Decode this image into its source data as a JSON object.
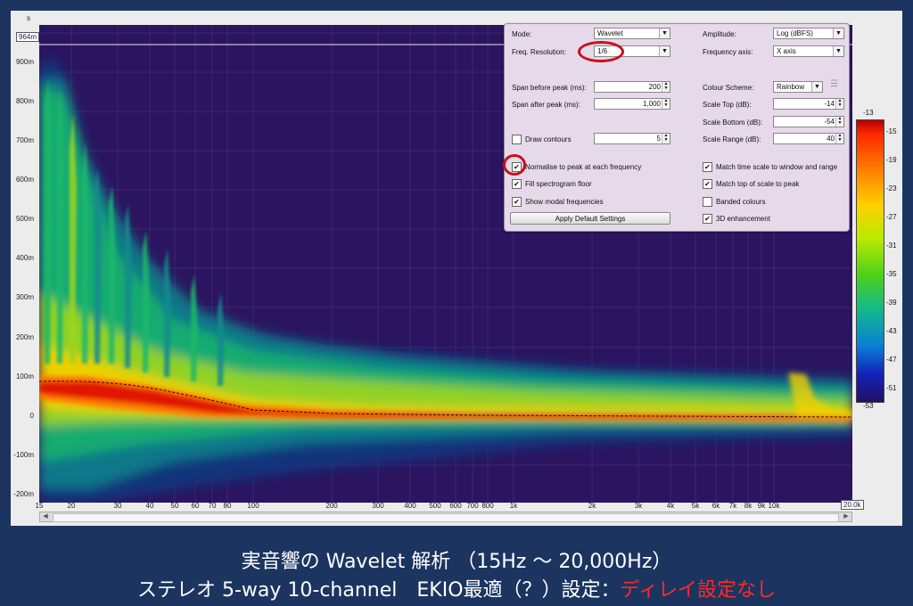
{
  "plot": {
    "unit_top": "s",
    "marker_label": "964m",
    "y_ticks": [
      "900m",
      "800m",
      "700m",
      "600m",
      "500m",
      "400m",
      "300m",
      "200m",
      "100m",
      "0",
      "-100m",
      "-200m"
    ],
    "x_ticks": [
      "15",
      "20",
      "30",
      "40",
      "50",
      "60",
      "70",
      "80",
      "100",
      "200",
      "300",
      "400",
      "500",
      "600",
      "700",
      "800",
      "1k",
      "2k",
      "3k",
      "4k",
      "5k",
      "6k",
      "7k",
      "8k",
      "9k",
      "10k",
      "20k"
    ],
    "freq_readout": "20.0k"
  },
  "panel": {
    "mode_label": "Mode:",
    "mode_value": "Wavelet",
    "amplitude_label": "Amplitude:",
    "amplitude_value": "Log (dBFS)",
    "freq_res_label": "Freq. Resolution:",
    "freq_res_value": "1/6",
    "freq_axis_label": "Frequency axis:",
    "freq_axis_value": "X axis",
    "span_before_label": "Span before peak (ms):",
    "span_before_value": "200",
    "span_after_label": "Span after peak (ms):",
    "span_after_value": "1,000",
    "colour_scheme_label": "Colour Scheme:",
    "colour_scheme_value": "Rainbow",
    "scale_top_label": "Scale Top (dB):",
    "scale_top_value": "-14",
    "scale_bottom_label": "Scale Bottom (dB):",
    "scale_bottom_value": "-54",
    "scale_range_label": "Scale Range (dB):",
    "scale_range_value": "40",
    "draw_contours_label": "Draw contours",
    "draw_contours_value": "5",
    "normalise_label": "Normalise to peak at each frequency",
    "fill_floor_label": "Fill spectrogram floor",
    "show_modal_label": "Show modal frequencies",
    "match_time_label": "Match time scale to window and range",
    "match_top_label": "Match top of scale to peak",
    "banded_label": "Banded colours",
    "enhance_3d_label": "3D enhancement",
    "apply_default_label": "Apply Default Settings",
    "checks": {
      "draw_contours": false,
      "normalise": true,
      "fill_floor": true,
      "show_modal": true,
      "match_time": true,
      "match_top": true,
      "banded": false,
      "enhance_3d": true
    },
    "check_mark": "✔",
    "dropdown_glyph": "▼",
    "spinner_up": "▲",
    "spinner_down": "▼",
    "slider_glyph": "☰"
  },
  "colorbar": {
    "top": "-13",
    "bottom": "-53",
    "ticks": [
      "-15",
      "-19",
      "-23",
      "-27",
      "-31",
      "-35",
      "-39",
      "-43",
      "-47",
      "-51"
    ]
  },
  "caption": {
    "line1": "実音響の Wavelet 解析 （15Hz ～ 20,000Hz）",
    "line2_main": "ステレオ 5-way 10-channel　EKIO最適（？）設定：",
    "line2_red": "ディレイ設定なし"
  },
  "colors": {
    "background": "#1b3560",
    "plot_floor": "#2b1560",
    "highlight": "#c8101d",
    "caption_red": "#ff2a2a"
  },
  "icons": {
    "scroll_left": "◀",
    "scroll_right": "▶"
  }
}
